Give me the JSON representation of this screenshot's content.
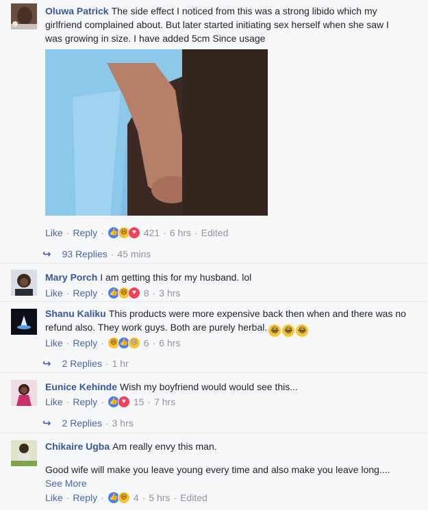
{
  "comments": [
    {
      "author": "Oluwa Patrick",
      "text": "The side effect I noticed from this was a strong libido which my girlfriend complained about. But later started initiating sex herself when she saw I was growing in size. I have added 5cm Since usage",
      "like_label": "Like",
      "reply_label": "Reply",
      "reactions": [
        "like",
        "haha",
        "love"
      ],
      "count": "421",
      "time": "6 hrs",
      "edited": "Edited",
      "replies_label": "93 Replies",
      "replies_time": "45 mins"
    },
    {
      "author": "Mary Porch",
      "text": "I am getting this for my husband. lol",
      "like_label": "Like",
      "reply_label": "Reply",
      "reactions": [
        "like",
        "haha",
        "love"
      ],
      "count": "8",
      "time": "3 hrs"
    },
    {
      "author": "Shanu Kaliku",
      "text": "This products were more expensive back then when and there was no refund also. They work guys. Both are purely herbal.",
      "like_label": "Like",
      "reply_label": "Reply",
      "reactions": [
        "haha",
        "like",
        "sad"
      ],
      "count": "6",
      "time": "6 hrs",
      "replies_label": "2 Replies",
      "replies_time": "1 hr"
    },
    {
      "author": "Eunice Kehinde",
      "text": "Wish my boyfriend would would see this...",
      "like_label": "Like",
      "reply_label": "Reply",
      "reactions": [
        "like",
        "love"
      ],
      "count": "15",
      "time": "7 hrs",
      "replies_label": "2 Replies",
      "replies_time": "3 hrs"
    },
    {
      "author": "Chikaire Ugba",
      "text": "Am really envy this man.",
      "text2": "Good wife will make you leave young every time and also make you leave long....",
      "see_more": "See More",
      "like_label": "Like",
      "reply_label": "Reply",
      "reactions": [
        "like",
        "haha"
      ],
      "count": "4",
      "time": "5 hrs",
      "edited": "Edited"
    }
  ],
  "icons": {
    "reply_arrow": "reply-arrow-icon",
    "like": "like-reaction-icon",
    "haha": "haha-reaction-icon",
    "love": "love-reaction-icon",
    "sad": "sad-reaction-icon",
    "laugh_emoji": "tears-of-joy-emoji"
  },
  "colors": {
    "author": "#365899",
    "link": "#4b67a1",
    "meta": "#90949c",
    "background": "#f6f7f9"
  }
}
